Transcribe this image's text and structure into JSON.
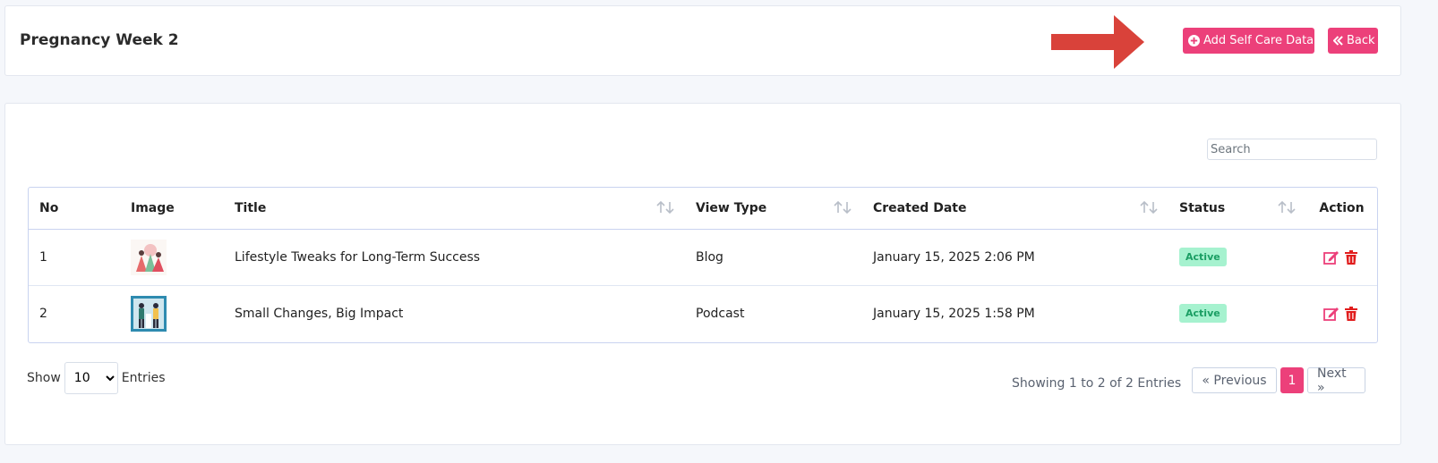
{
  "header": {
    "title": "Pregnancy Week 2",
    "add_button": "Add Self Care Data",
    "back_button": "Back"
  },
  "search": {
    "placeholder": "Search",
    "value": ""
  },
  "table": {
    "columns": [
      "No",
      "Image",
      "Title",
      "View Type",
      "Created Date",
      "Status",
      "Action"
    ],
    "rows": [
      {
        "no": "1",
        "image": "lifestyle-illustration",
        "title": "Lifestyle Tweaks for Long-Term Success",
        "view_type": "Blog",
        "created_date": "January 15, 2025 2:06 PM",
        "status": "Active"
      },
      {
        "no": "2",
        "image": "podcast-illustration",
        "title": "Small Changes, Big Impact",
        "view_type": "Podcast",
        "created_date": "January 15, 2025 1:58 PM",
        "status": "Active"
      }
    ]
  },
  "footer": {
    "show_label": "Show",
    "entries_label": "Entries",
    "page_size": "10",
    "info": "Showing 1 to 2 of 2 Entries",
    "prev": "« Previous",
    "current_page": "1",
    "next": "Next »"
  },
  "colors": {
    "accent": "#ec407a",
    "badge_bg": "#a6f2cf",
    "badge_text": "#1a9e63",
    "arrow": "#d9423a",
    "delete": "#e11d1d"
  }
}
